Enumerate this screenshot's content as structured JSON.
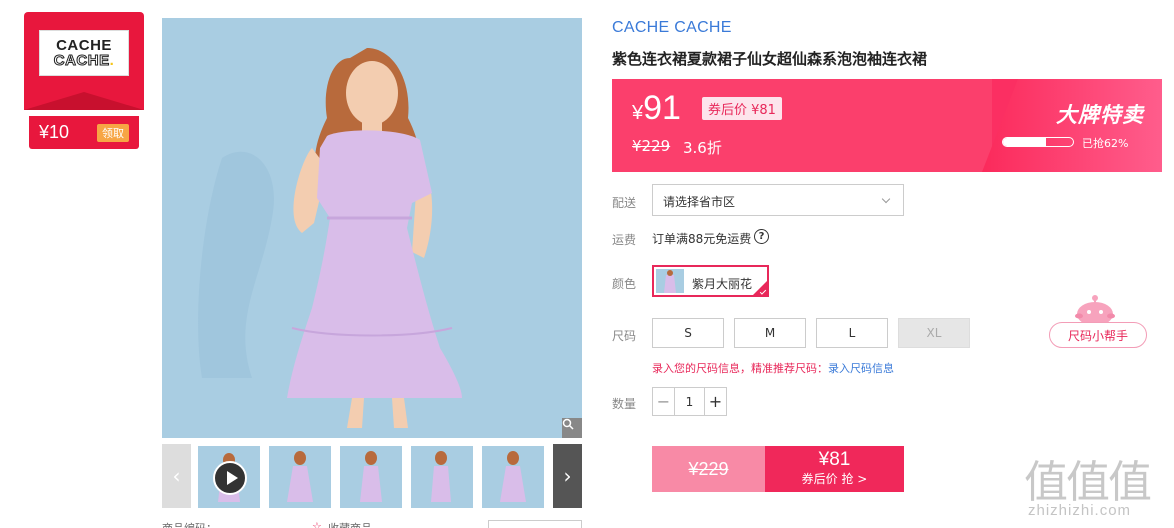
{
  "coupon": {
    "logo_line1": "CACHE",
    "logo_line2": "CACHE",
    "amount": "¥10",
    "claim_label": "领取"
  },
  "gallery": {
    "thumbnails": [
      "video",
      "photo",
      "photo",
      "photo",
      "photo"
    ],
    "bottom_labels": [
      "商品编码：",
      "收藏商品"
    ]
  },
  "product": {
    "brand": "CACHE CACHE",
    "title": "紫色连衣裙夏款裙子仙女超仙森系泡泡袖连衣裙"
  },
  "price": {
    "yen": "¥",
    "current": "91",
    "after_coupon": "券后价 ¥81",
    "original": "¥229",
    "discount": "3.6折",
    "flash_title": "大牌特卖",
    "sold_percent": 62,
    "sold_label": "已抢62%"
  },
  "delivery": {
    "label": "配送",
    "placeholder": "请选择省市区"
  },
  "shipping": {
    "label": "运费",
    "text": "订单满88元免运费"
  },
  "color": {
    "label": "颜色",
    "option": "紫月大丽花"
  },
  "size": {
    "label": "尺码",
    "options": [
      "S",
      "M",
      "L",
      "XL"
    ],
    "tip": "录入您的尺码信息，精准推荐尺码：",
    "tip_link": "录入尺码信息",
    "helper": "尺码小帮手"
  },
  "quantity": {
    "label": "数量",
    "minus": "−",
    "value": "1",
    "plus": "+"
  },
  "buy": {
    "original": "¥229",
    "price": "¥81",
    "sub": "券后价 抢 >"
  },
  "watermark": {
    "chars": "值值值",
    "url": "zhizhizhi.com"
  },
  "colors": {
    "accent": "#fb2f62",
    "brand_blue": "#3a7ad8",
    "coupon_red": "#e8173d"
  }
}
